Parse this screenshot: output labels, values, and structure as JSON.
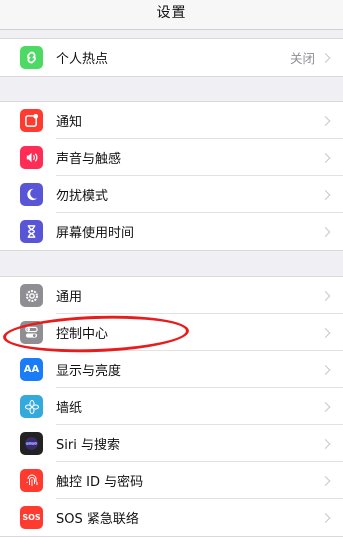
{
  "navbar": {
    "title": "设置"
  },
  "groups": [
    {
      "rows": [
        {
          "label": "个人热点",
          "value": "关闭",
          "icon": "link-icon",
          "color": "#4cd964"
        }
      ]
    },
    {
      "rows": [
        {
          "label": "通知",
          "icon": "notification-icon",
          "color": "#ff3b30"
        },
        {
          "label": "声音与触感",
          "icon": "speaker-icon",
          "color": "#ff2d55"
        },
        {
          "label": "勿扰模式",
          "icon": "moon-icon",
          "color": "#5856d6"
        },
        {
          "label": "屏幕使用时间",
          "icon": "hourglass-icon",
          "color": "#5856d6"
        }
      ]
    },
    {
      "rows": [
        {
          "label": "通用",
          "icon": "gear-icon",
          "color": "#8e8e93"
        },
        {
          "label": "控制中心",
          "icon": "toggle-icon",
          "color": "#8e8e93"
        },
        {
          "label": "显示与亮度",
          "icon": "text-size-icon",
          "color": "#1a7cf6",
          "icon_text": "AA"
        },
        {
          "label": "墙纸",
          "icon": "flower-icon",
          "color": "#34aadc"
        },
        {
          "label": "Siri 与搜索",
          "icon": "siri-icon",
          "color": "#222222"
        },
        {
          "label": "触控 ID 与密码",
          "icon": "fingerprint-icon",
          "color": "#ff3b30"
        },
        {
          "label": "SOS 紧急联络",
          "icon": "sos-icon",
          "color": "#ff3b30",
          "icon_text": "SOS"
        }
      ]
    }
  ],
  "annotation": {
    "color": "#e81c1c"
  }
}
